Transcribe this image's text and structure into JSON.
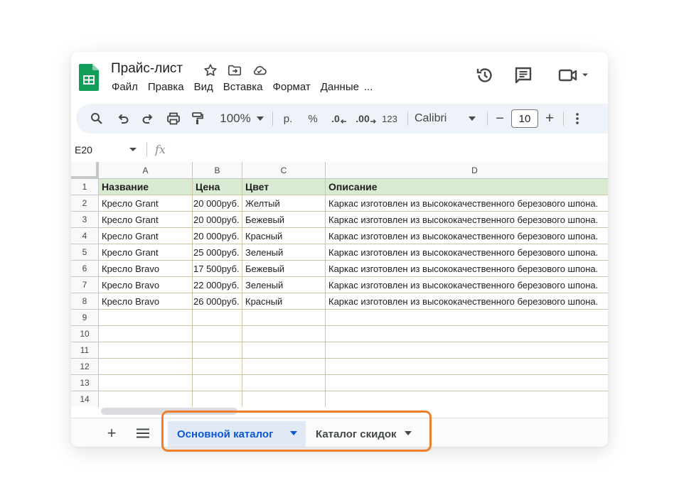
{
  "app": {
    "doc_title": "Прайс-лист",
    "menu": [
      "Файл",
      "Правка",
      "Вид",
      "Вставка",
      "Формат",
      "Данные",
      "..."
    ]
  },
  "toolbar": {
    "zoom": "100%",
    "currency": "р.",
    "percent": "%",
    "decrease_decimals": ".0",
    "increase_decimals": ".00",
    "number_format": "123",
    "font_family": "Calibri",
    "font_size": "10",
    "minus": "−",
    "plus": "+"
  },
  "formula_bar": {
    "name_box": "E20",
    "fx": "fx"
  },
  "grid": {
    "columns": [
      "A",
      "B",
      "C",
      "D"
    ],
    "row_numbers": [
      "1",
      "2",
      "3",
      "4",
      "5",
      "6",
      "7",
      "8",
      "9",
      "10",
      "11",
      "12",
      "13",
      "14"
    ],
    "header_row": [
      "Название",
      "Цена",
      "Цвет",
      "Описание"
    ],
    "rows": [
      [
        "Кресло Grant",
        "20 000руб.",
        "Желтый",
        "Каркас изготовлен из высококачественного березового шпона."
      ],
      [
        "Кресло Grant",
        "20 000руб.",
        "Бежевый",
        "Каркас изготовлен из высококачественного березового шпона."
      ],
      [
        "Кресло Grant",
        "20 000руб.",
        "Красный",
        "Каркас изготовлен из высококачественного березового шпона."
      ],
      [
        "Кресло Grant",
        "25 000руб.",
        "Зеленый",
        "Каркас изготовлен из высококачественного березового шпона."
      ],
      [
        "Кресло Bravo",
        "17 500руб.",
        "Бежевый",
        "Каркас изготовлен из высококачественного березового шпона."
      ],
      [
        "Кресло Bravo",
        "22 000руб.",
        "Зеленый",
        "Каркас изготовлен из высококачественного березового шпона."
      ],
      [
        "Кресло Bravo",
        "26 000руб.",
        "Красный",
        "Каркас изготовлен из высококачественного березового шпона."
      ]
    ]
  },
  "sheet_tabs": {
    "add": "+",
    "tabs": [
      "Основной каталог",
      "Каталог скидок"
    ],
    "active_index": 0
  },
  "colors": {
    "header_fill": "#d9ead3",
    "active_tab_text": "#0b57d0",
    "highlight": "#f07f2d",
    "logo_green": "#0f9d58"
  }
}
